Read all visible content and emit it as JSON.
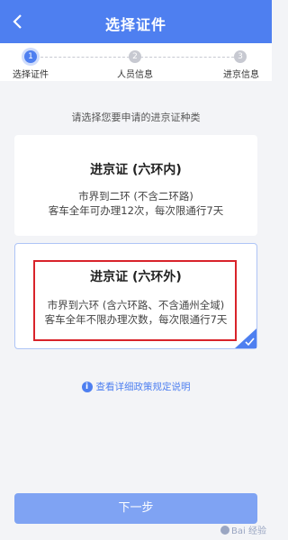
{
  "header": {
    "title": "选择证件",
    "back_icon": "chevron-left-icon"
  },
  "steps": [
    {
      "number": "1",
      "label": "选择证件",
      "state": "active"
    },
    {
      "number": "2",
      "label": "人员信息",
      "state": "inactive"
    },
    {
      "number": "3",
      "label": "进京信息",
      "state": "inactive"
    }
  ],
  "prompt": "请选择您要申请的进京证种类",
  "options": [
    {
      "title": "进京证 (六环内)",
      "line1": "市界到二环 (不含二环路)",
      "line2": "客车全年可办理12次，每次限通行7天",
      "selected": false
    },
    {
      "title": "进京证 (六环外)",
      "line1": "市界到六环 (含六环路、不含通州全域)",
      "line2": "客车全年不限办理次数，每次限通行7天",
      "selected": true
    }
  ],
  "policy_link": "查看详细政策规定说明",
  "next_button": "下一步",
  "watermark": "Bai 经验",
  "colors": {
    "primary": "#4e7ff0",
    "button": "#7fa3f3",
    "highlight": "#d8232a"
  }
}
